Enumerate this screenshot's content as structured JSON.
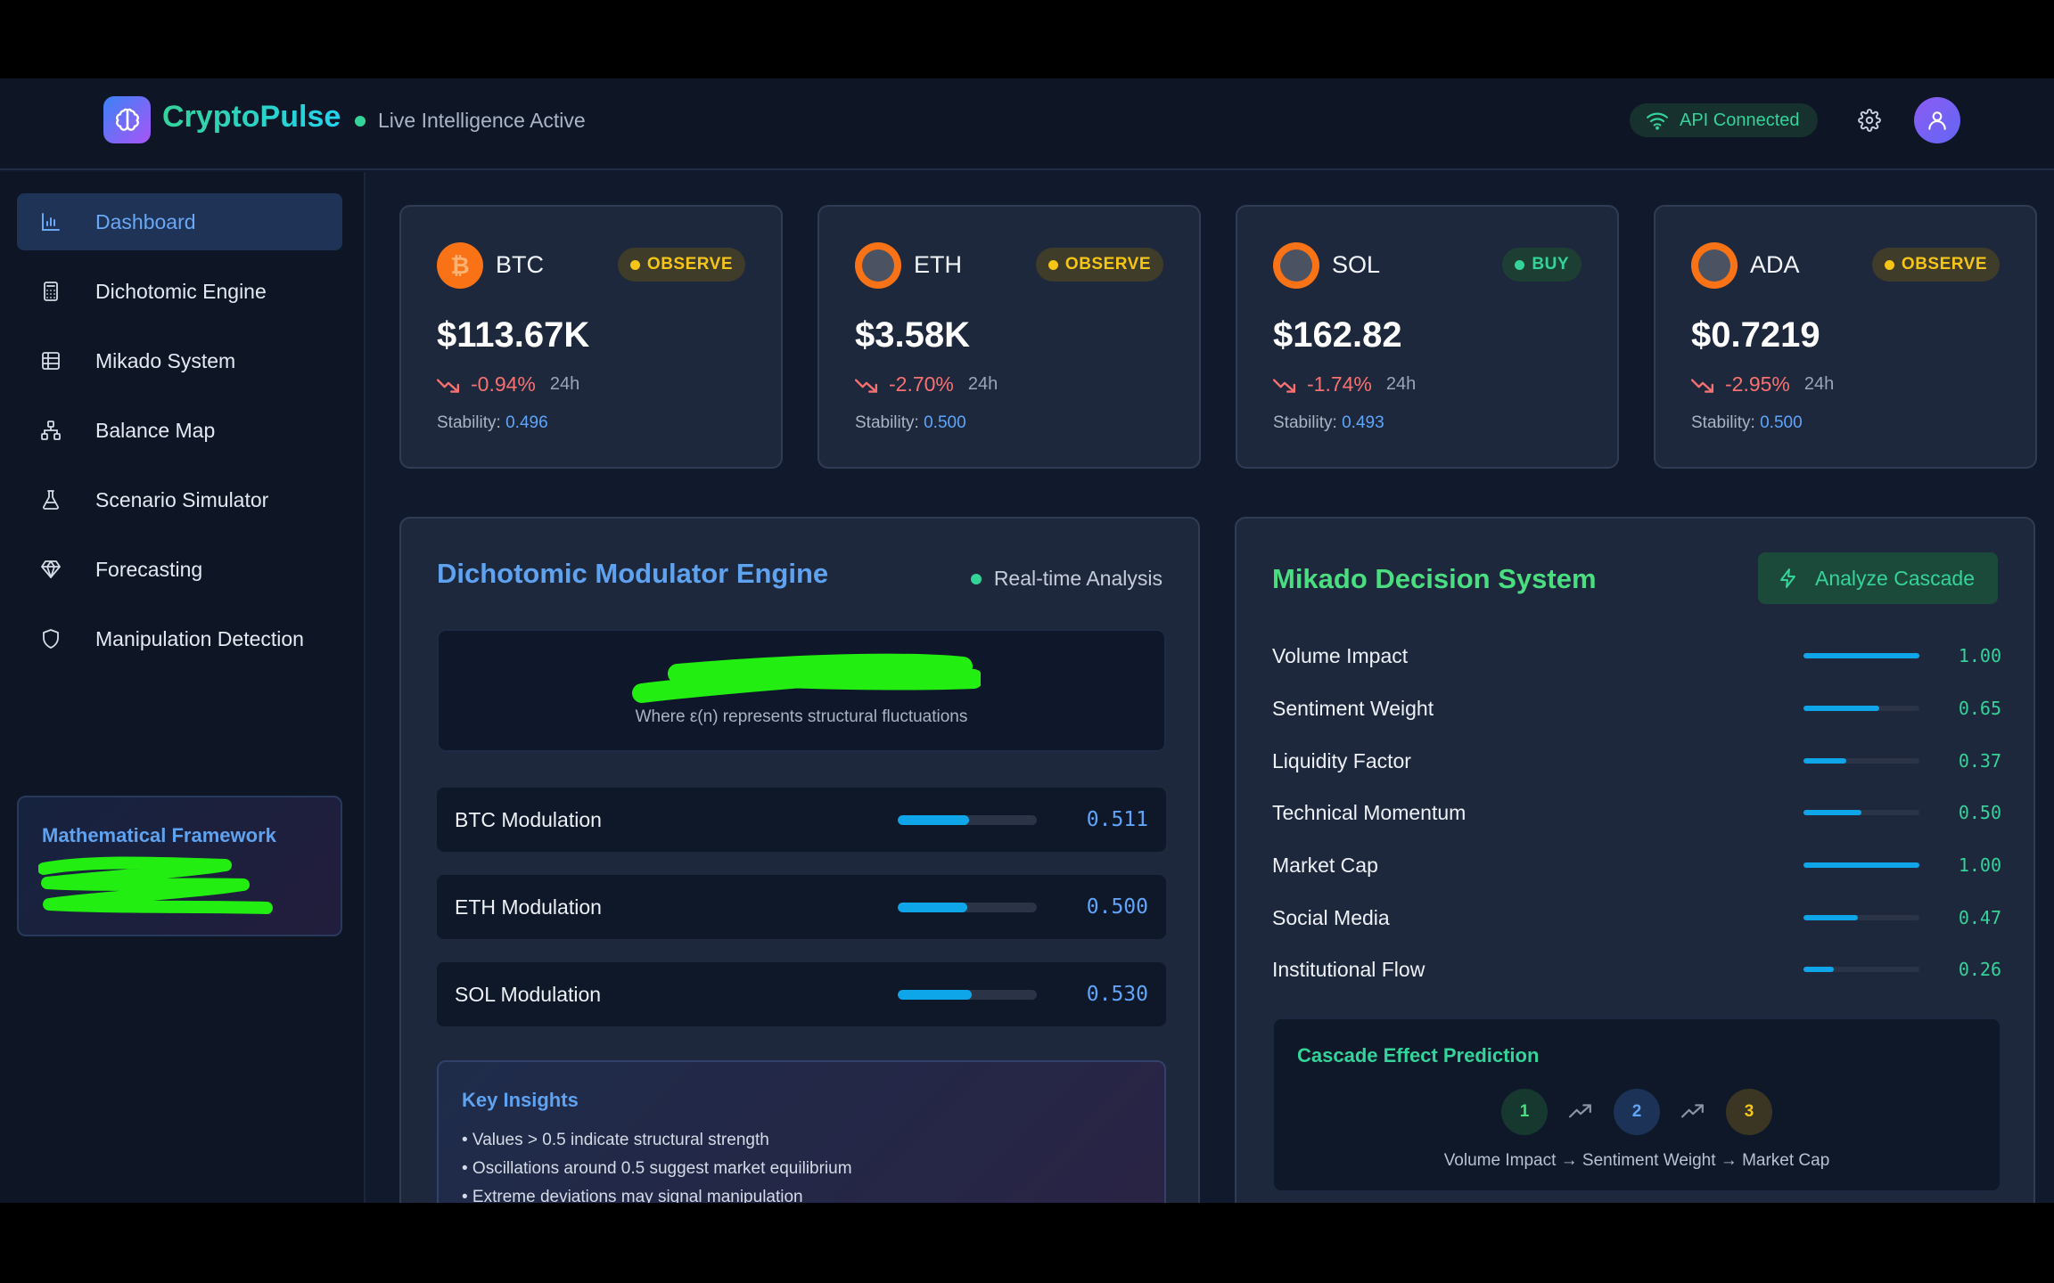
{
  "header": {
    "brand": "CryptoPulse",
    "status_text": "Live Intelligence Active",
    "api_status": "API Connected",
    "logo_icon": "brain-icon",
    "colors": {
      "accent_green": "#34d399",
      "accent_blue": "#60a5fa"
    }
  },
  "sidebar": {
    "items": [
      {
        "label": "Dashboard",
        "icon": "bar-chart-icon",
        "active": true
      },
      {
        "label": "Dichotomic Engine",
        "icon": "calculator-icon",
        "active": false
      },
      {
        "label": "Mikado System",
        "icon": "grid-icon",
        "active": false
      },
      {
        "label": "Balance Map",
        "icon": "network-icon",
        "active": false
      },
      {
        "label": "Scenario Simulator",
        "icon": "flask-icon",
        "active": false
      },
      {
        "label": "Forecasting",
        "icon": "gem-icon",
        "active": false
      },
      {
        "label": "Manipulation Detection",
        "icon": "shield-icon",
        "active": false
      }
    ],
    "framework": {
      "title": "Mathematical Framework"
    }
  },
  "coins": [
    {
      "symbol": "BTC",
      "signal": "OBSERVE",
      "price": "$113.67K",
      "change": "-0.94%",
      "period": "24h",
      "stability_label": "Stability:",
      "stability": "0.496"
    },
    {
      "symbol": "ETH",
      "signal": "OBSERVE",
      "price": "$3.58K",
      "change": "-2.70%",
      "period": "24h",
      "stability_label": "Stability:",
      "stability": "0.500"
    },
    {
      "symbol": "SOL",
      "signal": "BUY",
      "price": "$162.82",
      "change": "-1.74%",
      "period": "24h",
      "stability_label": "Stability:",
      "stability": "0.493"
    },
    {
      "symbol": "ADA",
      "signal": "OBSERVE",
      "price": "$0.7219",
      "change": "-2.95%",
      "period": "24h",
      "stability_label": "Stability:",
      "stability": "0.500"
    }
  ],
  "dichotomic": {
    "title": "Dichotomic Modulator Engine",
    "status": "Real-time Analysis",
    "formula_caption": "Where ε(n) represents structural fluctuations",
    "modulations": [
      {
        "label": "BTC Modulation",
        "value": "0.511",
        "fill": 0.511
      },
      {
        "label": "ETH Modulation",
        "value": "0.500",
        "fill": 0.5
      },
      {
        "label": "SOL Modulation",
        "value": "0.530",
        "fill": 0.53
      }
    ],
    "insights": {
      "title": "Key Insights",
      "items": [
        "• Values > 0.5 indicate structural strength",
        "• Oscillations around 0.5 suggest market equilibrium",
        "• Extreme deviations may signal manipulation"
      ]
    }
  },
  "mikado": {
    "title": "Mikado Decision System",
    "button": "Analyze Cascade",
    "factors": [
      {
        "label": "Volume Impact",
        "value": "1.00",
        "fill": 1.0
      },
      {
        "label": "Sentiment Weight",
        "value": "0.65",
        "fill": 0.65
      },
      {
        "label": "Liquidity Factor",
        "value": "0.37",
        "fill": 0.37
      },
      {
        "label": "Technical Momentum",
        "value": "0.50",
        "fill": 0.5
      },
      {
        "label": "Market Cap",
        "value": "1.00",
        "fill": 1.0
      },
      {
        "label": "Social Media",
        "value": "0.47",
        "fill": 0.47
      },
      {
        "label": "Institutional Flow",
        "value": "0.26",
        "fill": 0.26
      }
    ],
    "cascade": {
      "title": "Cascade Effect Prediction",
      "steps": [
        "1",
        "2",
        "3"
      ],
      "path": "Volume Impact → Sentiment Weight → Market Cap"
    }
  }
}
